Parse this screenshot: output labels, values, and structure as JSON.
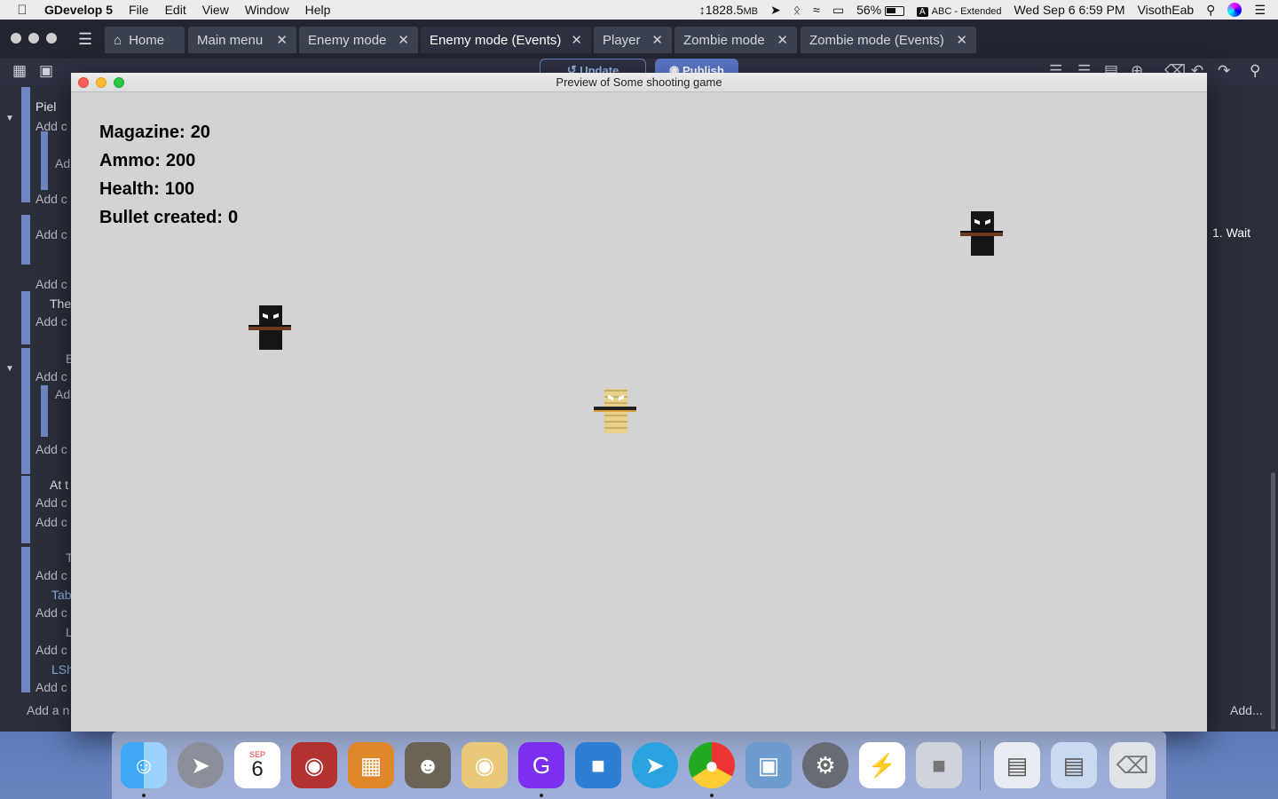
{
  "menubar": {
    "app_name": "GDevelop 5",
    "menus": [
      "File",
      "Edit",
      "View",
      "Window",
      "Help"
    ],
    "memory": "1828.5",
    "memory_unit": "MB",
    "battery": "56%",
    "input_source": "ABC - Extended",
    "input_badge": "A",
    "datetime": "Wed Sep 6  6:59 PM",
    "user": "VisothEab"
  },
  "tabs": [
    {
      "label": "Home"
    },
    {
      "label": "Main menu"
    },
    {
      "label": "Enemy mode"
    },
    {
      "label": "Enemy mode (Events)"
    },
    {
      "label": "Player"
    },
    {
      "label": "Zombie mode"
    },
    {
      "label": "Zombie mode (Events)"
    }
  ],
  "toolbar": {
    "update_label": "Update",
    "publish_label": "Publish"
  },
  "events": {
    "lines": [
      "Piel",
      "Add c",
      "Ad",
      "Add c",
      "Add c",
      "Add c",
      "The",
      "Add c",
      "E",
      "Add c",
      "Ad",
      "Add c",
      "At t",
      "Add c",
      "Add c",
      "T",
      "Add c",
      "Tab",
      "Add c",
      "L",
      "Add c",
      "LSh",
      "Add c",
      "Add a n"
    ],
    "right_text": "1. Wait",
    "right_add": "Add..."
  },
  "preview": {
    "title": "Preview of Some shooting game",
    "hud": [
      {
        "label": "Magazine:",
        "value": "20"
      },
      {
        "label": "Ammo:",
        "value": "200"
      },
      {
        "label": "Health:",
        "value": "100"
      },
      {
        "label": "Bullet created:",
        "value": "0"
      }
    ]
  },
  "dock": {
    "calendar_month": "SEP",
    "calendar_day": "6",
    "apps": [
      "finder-icon",
      "launchpad-icon",
      "calendar-icon",
      "photo-booth-icon",
      "calculator-icon",
      "gimp-icon",
      "paint-icon",
      "gdevelop-icon",
      "lego-icon",
      "telegram-icon",
      "chrome-icon",
      "preview-icon",
      "system-preferences-icon",
      "messenger-icon",
      "roblox-icon",
      "downloads-stack-icon",
      "documents-stack-icon",
      "trash-icon"
    ]
  }
}
